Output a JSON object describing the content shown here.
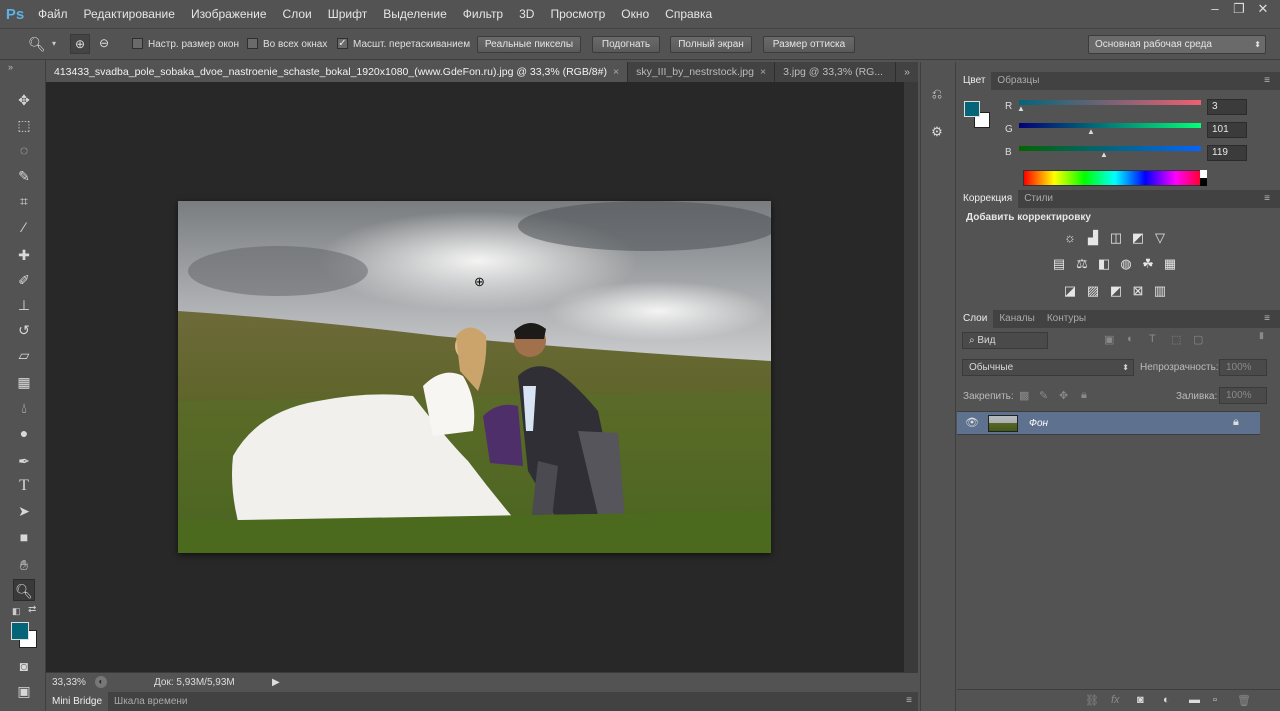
{
  "app": {
    "logo": "Ps"
  },
  "menu": [
    "Файл",
    "Редактирование",
    "Изображение",
    "Слои",
    "Шрифт",
    "Выделение",
    "Фильтр",
    "3D",
    "Просмотр",
    "Окно",
    "Справка"
  ],
  "options": {
    "resize_windows": "Настр. размер окон",
    "all_windows": "Во всех окнах",
    "scrubby_zoom": "Масшт. перетаскиванием",
    "actual_pixels": "Реальные пикселы",
    "fit_screen": "Подогнать",
    "fill_screen": "Полный экран",
    "print_size": "Размер оттиска",
    "workspace": "Основная рабочая среда"
  },
  "tabs": [
    {
      "label": "413433_svadba_pole_sobaka_dvoe_nastroenie_schaste_bokal_1920x1080_(www.GdeFon.ru).jpg @ 33,3% (RGB/8#)",
      "close": "×"
    },
    {
      "label": "sky_III_by_nestrstock.jpg",
      "close": "×"
    },
    {
      "label": "3.jpg @ 33,3% (RG...",
      "close": ""
    }
  ],
  "tabs_overflow": "»",
  "status": {
    "zoom": "33,33%",
    "doc": "Док: 5,93M/5,93M",
    "arrow": "▶"
  },
  "bottom_tabs": {
    "mini_bridge": "Mini Bridge",
    "timeline": "Шкала времени"
  },
  "color_panel": {
    "tab_color": "Цвет",
    "tab_swatches": "Образцы",
    "r_label": "R",
    "g_label": "G",
    "b_label": "B",
    "r": "3",
    "g": "101",
    "b": "119",
    "foreground": "#036577",
    "background": "#ffffff"
  },
  "adjustments": {
    "tab": "Коррекция",
    "tab_styles": "Стили",
    "title": "Добавить корректировку",
    "row1": [
      "brightness-icon",
      "levels-icon",
      "curves-icon",
      "exposure-icon",
      "vibrance-icon"
    ],
    "row2": [
      "hue-saturation-icon",
      "color-balance-icon",
      "black-white-icon",
      "photo-filter-icon",
      "channel-mixer-icon",
      "color-lookup-icon"
    ],
    "row3": [
      "invert-icon",
      "posterize-icon",
      "threshold-icon",
      "selective-color-icon",
      "gradient-map-icon"
    ]
  },
  "layers": {
    "tab_layers": "Слои",
    "tab_channels": "Каналы",
    "tab_paths": "Контуры",
    "filter": "Вид",
    "blend": "Обычные",
    "opacity_label": "Непрозрачность:",
    "opacity_value": "100%",
    "lock_label": "Закрепить:",
    "fill_label": "Заливка:",
    "fill_value": "100%",
    "layer_name": "Фон"
  }
}
